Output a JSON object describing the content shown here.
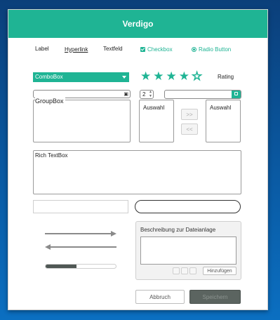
{
  "window": {
    "title": "Verdigo"
  },
  "controls": {
    "label": "Label",
    "hyperlink": "Hyperlink",
    "textfeld": "Textfeld",
    "checkbox": "Checkbox",
    "radio_button": "Radio Button",
    "combobox": "ComboBox",
    "rating": {
      "label": "Rating",
      "value": 4,
      "max": 5
    },
    "numeric_value": "2",
    "groupbox": "GroupBox",
    "list_left": "Auswahl",
    "list_right": "Auswahl",
    "move_right": ">>",
    "move_left": "<<",
    "rich_textbox": "Rich TextBox",
    "progress": 0.44
  },
  "attachment": {
    "title": "Beschreibung zur Dateianlage",
    "add_button": "Hinzufügen"
  },
  "footer": {
    "cancel": "Abbruch",
    "save": "Speichern"
  },
  "colors": {
    "accent": "#1fb494",
    "dark": "#5b6460"
  }
}
